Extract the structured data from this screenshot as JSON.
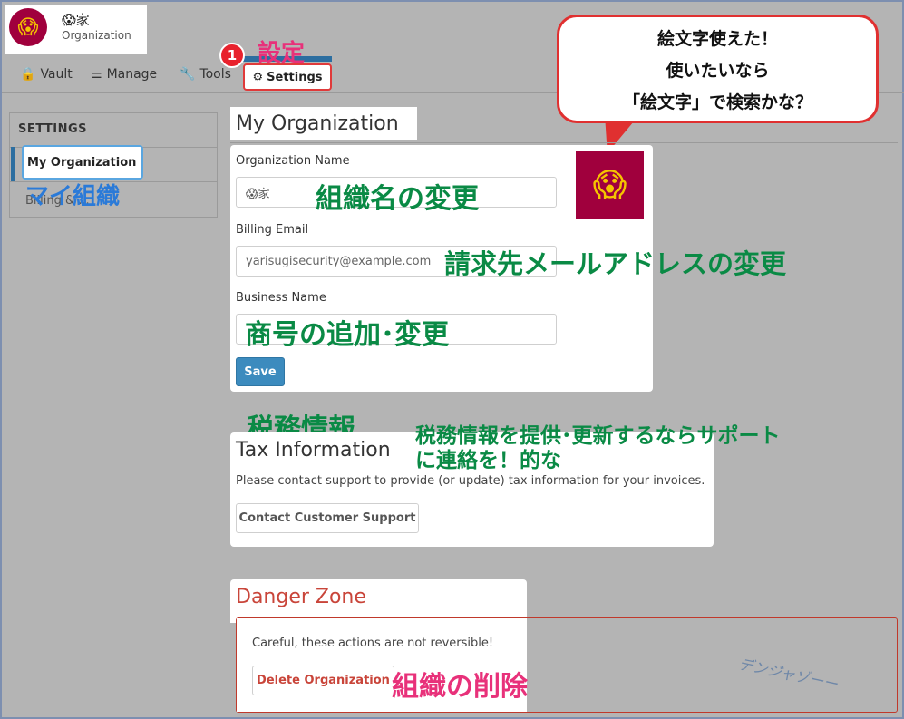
{
  "org": {
    "emoji": "😱",
    "name": "😱家",
    "type": "Organization"
  },
  "tabs": {
    "vault": "Vault",
    "manage": "Manage",
    "tools": "Tools",
    "settings": "Settings"
  },
  "annotations": {
    "badge": "1",
    "settei": "設定",
    "callout_lines": [
      "絵文字使えた！",
      "使いたいなら",
      "「絵文字」で検索かな？"
    ],
    "my_org_jp": "マイ組織",
    "org_name_change": "組織名の変更",
    "billing_change": "請求先メールアドレスの変更",
    "business_change": "商号の追加･変更",
    "tax_jp": "税務情報",
    "tax_note_1": "税務情報を提供･更新するならサポート",
    "tax_note_2": "に連絡を！的な",
    "delete_jp": "組織の削除",
    "signature": "デンジャゾーー"
  },
  "sidebar": {
    "heading": "SETTINGS",
    "items": [
      "My Organization",
      "Billing & ..."
    ]
  },
  "main": {
    "title": "My Organization",
    "org_name_label": "Organization Name",
    "org_name_value": "😱家",
    "billing_email_label": "Billing Email",
    "billing_email_value": "yarisugisecurity@example.com",
    "business_name_label": "Business Name",
    "business_name_value": "",
    "save_label": "Save"
  },
  "tax": {
    "title": "Tax Information",
    "text": "Please contact support to provide (or update) tax information for your invoices.",
    "button": "Contact Customer Support"
  },
  "danger": {
    "title": "Danger Zone",
    "text": "Careful, these actions are not reversible!",
    "button": "Delete Organization"
  },
  "colors": {
    "accent": "#2c6ea0",
    "danger": "#c9453a",
    "annotation_green": "#0a8a45",
    "annotation_pink": "#e8317a",
    "annotation_blue": "#2a7ad8",
    "avatar_bg": "#a0003d"
  }
}
